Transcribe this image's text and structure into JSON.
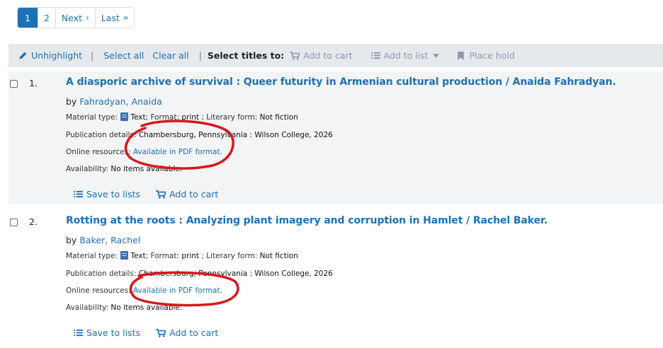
{
  "pagination": {
    "pages": [
      "1",
      "2"
    ],
    "next_label": "Next",
    "next_glyph": "›",
    "last_label": "Last",
    "last_glyph": "»"
  },
  "toolbar": {
    "unhighlight": "Unhighlight",
    "divider": "|",
    "select_all": "Select all",
    "clear_all": "Clear all",
    "select_titles_label": "Select titles to:",
    "add_to_cart": "Add to cart",
    "add_to_list": "Add to list",
    "place_hold": "Place hold"
  },
  "results": [
    {
      "number": "1.",
      "title": "A diasporic archive of survival : Queer futurity in Armenian cultural production / Anaida Fahradyan.",
      "by_label": "by",
      "author": "Fahradyan, Anaida",
      "material_label": "Material type:",
      "material_value": "Text",
      "format_label": "; Format:",
      "format_value": "print",
      "literary_label": "; Literary form:",
      "literary_value": "Not fiction",
      "publication_label": "Publication details:",
      "publication_value": "Chambersburg, Pennsylvania : Wilson College, 2026",
      "online_label": "Online resources:",
      "online_value": "Available in PDF format.",
      "availability_label": "Availability:",
      "availability_value": "No items available.",
      "save_label": "Save to lists",
      "cart_label": "Add to cart"
    },
    {
      "number": "2.",
      "title": "Rotting at the roots : Analyzing plant imagery and corruption in Hamlet / Rachel Baker.",
      "by_label": "by",
      "author": "Baker, Rachel",
      "material_label": "Material type:",
      "material_value": "Text",
      "format_label": "; Format:",
      "format_value": "print",
      "literary_label": "; Literary form:",
      "literary_value": "Not fiction",
      "publication_label": "Publication details:",
      "publication_value": "Chambersburg, Pennsylvania : Wilson College, 2026",
      "online_label": "Online resources:",
      "online_value": "Available in PDF format.",
      "availability_label": "Availability:",
      "availability_value": "No items available.",
      "save_label": "Save to lists",
      "cart_label": "Add to cart"
    }
  ],
  "colors": {
    "link": "#1d70b7",
    "toolbar_bg": "#e6e9ec",
    "row_alt_bg": "#f3f4f5",
    "annotation": "#d9161b"
  },
  "icons": [
    "pencil-icon",
    "cart-icon",
    "list-icon",
    "bookmark-icon",
    "book-icon",
    "caret-down-icon"
  ]
}
